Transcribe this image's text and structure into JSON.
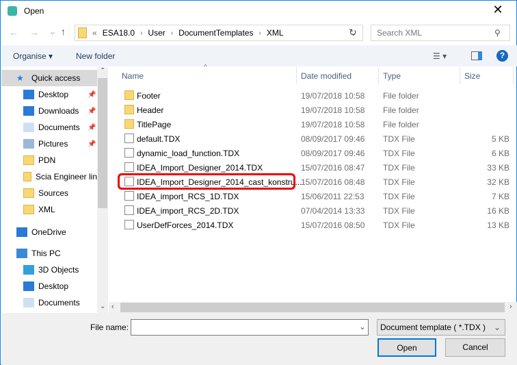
{
  "window": {
    "title": "Open",
    "close": "✕"
  },
  "nav": {
    "back": "←",
    "forward": "→",
    "recent": "⌄",
    "up": "↑",
    "refresh": "↻"
  },
  "address": {
    "prefix": "«",
    "crumbs": [
      "ESA18.0",
      "User",
      "DocumentTemplates",
      "XML"
    ]
  },
  "search": {
    "placeholder": "Search XML"
  },
  "toolbar": {
    "organise": "Organise ▾",
    "new_folder": "New folder",
    "help": "?"
  },
  "sidebar": {
    "items": [
      {
        "label": "Quick access",
        "icon": "star-icon",
        "selected": true
      },
      {
        "label": "Desktop",
        "icon": "desktop-icon",
        "pinned": true
      },
      {
        "label": "Downloads",
        "icon": "download-icon",
        "pinned": true
      },
      {
        "label": "Documents",
        "icon": "documents-icon",
        "pinned": true
      },
      {
        "label": "Pictures",
        "icon": "pictures-icon",
        "pinned": true
      },
      {
        "label": "PDN",
        "icon": "folder-icon"
      },
      {
        "label": "Scia Engineer lin",
        "icon": "folder-icon"
      },
      {
        "label": "Sources",
        "icon": "folder-icon"
      },
      {
        "label": "XML",
        "icon": "folder-icon"
      },
      {
        "label": "OneDrive",
        "icon": "cloud-icon"
      },
      {
        "label": "This PC",
        "icon": "computer-icon"
      },
      {
        "label": "3D Objects",
        "icon": "cube-icon"
      },
      {
        "label": "Desktop",
        "icon": "desktop-icon"
      },
      {
        "label": "Documents",
        "icon": "documents-icon"
      }
    ]
  },
  "columns": {
    "name": "Name",
    "date": "Date modified",
    "type": "Type",
    "size": "Size"
  },
  "files": [
    {
      "name": "Footer",
      "date": "19/07/2018 10:58",
      "type": "File folder",
      "size": "",
      "folder": true
    },
    {
      "name": "Header",
      "date": "19/07/2018 10:58",
      "type": "File folder",
      "size": "",
      "folder": true
    },
    {
      "name": "TitlePage",
      "date": "19/07/2018 10:58",
      "type": "File folder",
      "size": "",
      "folder": true
    },
    {
      "name": "default.TDX",
      "date": "08/09/2017 09:46",
      "type": "TDX File",
      "size": "5 KB"
    },
    {
      "name": "dynamic_load_function.TDX",
      "date": "08/09/2017 09:46",
      "type": "TDX File",
      "size": "6 KB"
    },
    {
      "name": "IDEA_Import_Designer_2014.TDX",
      "date": "15/07/2016 08:47",
      "type": "TDX File",
      "size": "33 KB"
    },
    {
      "name": "IDEA_Import_Designer_2014_cast_konstru...",
      "date": "15/07/2016 08:48",
      "type": "TDX File",
      "size": "32 KB",
      "highlighted": true
    },
    {
      "name": "IDEA_import_RCS_1D.TDX",
      "date": "15/06/2011 22:53",
      "type": "TDX File",
      "size": "7 KB"
    },
    {
      "name": "IDEA_import_RCS_2D.TDX",
      "date": "07/04/2014 13:33",
      "type": "TDX File",
      "size": "16 KB"
    },
    {
      "name": "UserDefForces_2014.TDX",
      "date": "15/07/2016 08:50",
      "type": "TDX File",
      "size": "13 KB"
    }
  ],
  "footer": {
    "file_name_label": "File name:",
    "file_name_value": "",
    "file_type": "Document template ( *.TDX )",
    "open": "Open",
    "cancel": "Cancel"
  },
  "colors": {
    "accent": "#1883d7",
    "highlight": "#e00000"
  }
}
